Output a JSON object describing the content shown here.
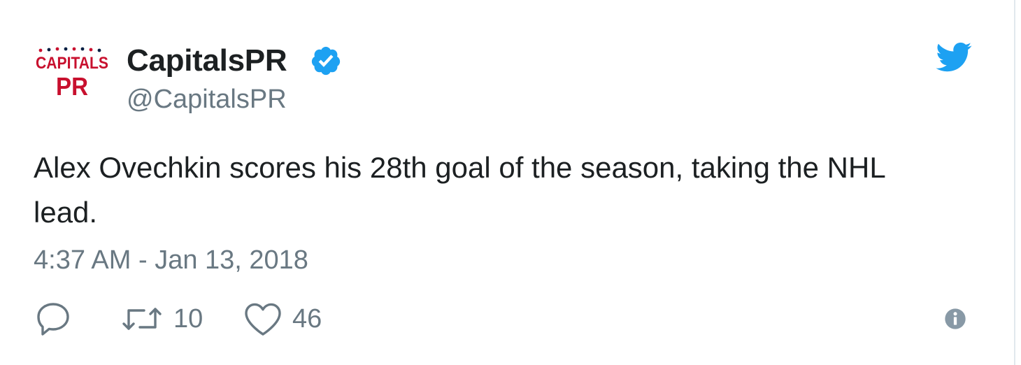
{
  "author": {
    "avatar_top_text": "CAPITALS",
    "avatar_bottom_text": "PR",
    "name": "CapitalsPR",
    "handle": "@CapitalsPR",
    "verified": true
  },
  "tweet": {
    "text": "Alex Ovechkin scores his 28th goal of the season, taking the NHL lead.",
    "timestamp": "4:37 AM - Jan 13, 2018"
  },
  "actions": {
    "retweet_count": "10",
    "like_count": "46"
  },
  "icons": {
    "reply": "reply-icon",
    "retweet": "retweet-icon",
    "like": "heart-icon",
    "info": "info-icon",
    "brand": "twitter-bird-icon",
    "verified": "verified-badge-icon"
  },
  "colors": {
    "twitter_blue": "#1da1f2",
    "text": "#1c2022",
    "secondary": "#697882",
    "avatar_red": "#c8102e",
    "avatar_navy": "#041e42"
  }
}
